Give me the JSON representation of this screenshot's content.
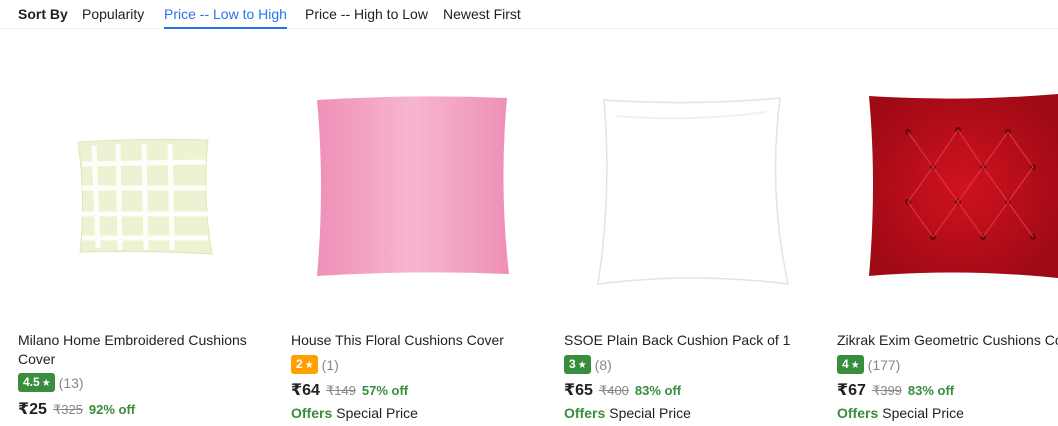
{
  "sort_bar": {
    "title": "Sort By",
    "options": [
      "Popularity",
      "Price -- Low to High",
      "Price -- High to Low",
      "Newest First"
    ],
    "active": "Price -- Low to High"
  },
  "colors": {
    "accent": "#2874f0",
    "rating_green": "#388e3c",
    "rating_orange": "#ff9f00",
    "discount_green": "#388e3c"
  },
  "products": [
    {
      "title": "Milano Home Embroidered Cushions Cover",
      "rating": "4.5",
      "rating_color": "#388e3c",
      "reviews": "(13)",
      "price": "₹25",
      "mrp": "₹325",
      "discount": "92% off",
      "image_icon": "checked-cushion-image"
    },
    {
      "title": "House This Floral Cushions Cover",
      "rating": "2",
      "rating_color": "#ff9f00",
      "reviews": "(1)",
      "price": "₹64",
      "mrp": "₹149",
      "discount": "57% off",
      "offers_label": "Offers",
      "offers_text": "Special Price",
      "image_icon": "pink-cushion-image"
    },
    {
      "title": "SSOE Plain Back Cushion Pack of 1",
      "rating": "3",
      "rating_color": "#388e3c",
      "reviews": "(8)",
      "price": "₹65",
      "mrp": "₹400",
      "discount": "83% off",
      "offers_label": "Offers",
      "offers_text": "Special Price",
      "image_icon": "white-cushion-image"
    },
    {
      "title": "Zikrak Exim Geometric Cushions Cover",
      "rating": "4",
      "rating_color": "#388e3c",
      "reviews": "(177)",
      "price": "₹67",
      "mrp": "₹399",
      "discount": "83% off",
      "offers_label": "Offers",
      "offers_text": "Special Price",
      "image_icon": "red-tufted-cushion-image"
    }
  ]
}
